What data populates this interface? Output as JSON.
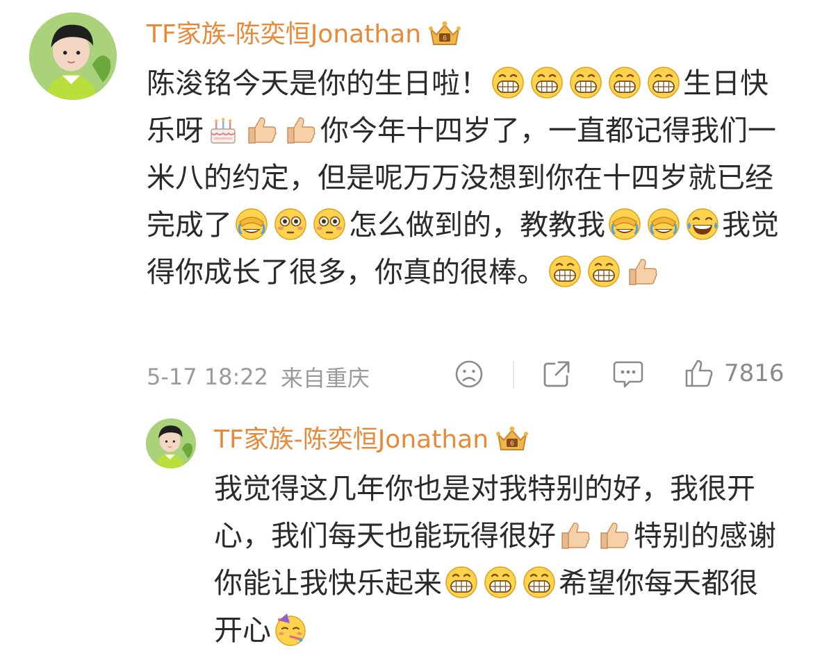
{
  "comment": {
    "username": "TF家族-陈奕恒Jonathan",
    "segments": [
      {
        "t": "text",
        "v": "陈浚铭今天是你的生日啦！"
      },
      {
        "t": "emoji",
        "v": "grin"
      },
      {
        "t": "emoji",
        "v": "grin"
      },
      {
        "t": "emoji",
        "v": "grin"
      },
      {
        "t": "emoji",
        "v": "grin"
      },
      {
        "t": "emoji",
        "v": "grin"
      },
      {
        "t": "text",
        "v": "生日快乐呀"
      },
      {
        "t": "emoji",
        "v": "cake"
      },
      {
        "t": "emoji",
        "v": "thumbs-up"
      },
      {
        "t": "emoji",
        "v": "thumbs-up"
      },
      {
        "t": "text",
        "v": "你今年十四岁了，一直都记得我们一米八的约定，但是呢万万没想到你在十四岁就已经完成了"
      },
      {
        "t": "emoji",
        "v": "facepalm-laugh"
      },
      {
        "t": "emoji",
        "v": "flushed"
      },
      {
        "t": "emoji",
        "v": "flushed"
      },
      {
        "t": "text",
        "v": "怎么做到的，教教我"
      },
      {
        "t": "emoji",
        "v": "facepalm-laugh"
      },
      {
        "t": "emoji",
        "v": "facepalm-laugh"
      },
      {
        "t": "emoji",
        "v": "tears-of-joy"
      },
      {
        "t": "text",
        "v": "我觉得你成长了很多，你真的很棒。"
      },
      {
        "t": "emoji",
        "v": "grin"
      },
      {
        "t": "emoji",
        "v": "grin"
      },
      {
        "t": "emoji",
        "v": "thumbs-up"
      }
    ],
    "time": "5-17 18:22",
    "location": "来自重庆",
    "like_count": "7816"
  },
  "reply": {
    "username": "TF家族-陈奕恒Jonathan",
    "segments": [
      {
        "t": "text",
        "v": "我觉得这几年你也是对我特别的好，我很开心，我们每天也能玩得很好"
      },
      {
        "t": "emoji",
        "v": "thumbs-up"
      },
      {
        "t": "emoji",
        "v": "thumbs-up"
      },
      {
        "t": "text",
        "v": "特别的感谢你能让我快乐起来"
      },
      {
        "t": "emoji",
        "v": "grin"
      },
      {
        "t": "emoji",
        "v": "grin"
      },
      {
        "t": "emoji",
        "v": "grin"
      },
      {
        "t": "text",
        "v": "希望你每天都很开心"
      },
      {
        "t": "emoji",
        "v": "party-face"
      }
    ]
  },
  "icons": {
    "badge": "crown-badge-icon",
    "dislike": "frown-face-icon",
    "share": "share-icon",
    "reply": "comment-bubble-icon",
    "like": "thumbs-up-outline-icon"
  },
  "colors": {
    "username": "#e8893a",
    "meta": "#9a9a9a",
    "avatar_bg": "#a8d07a"
  }
}
